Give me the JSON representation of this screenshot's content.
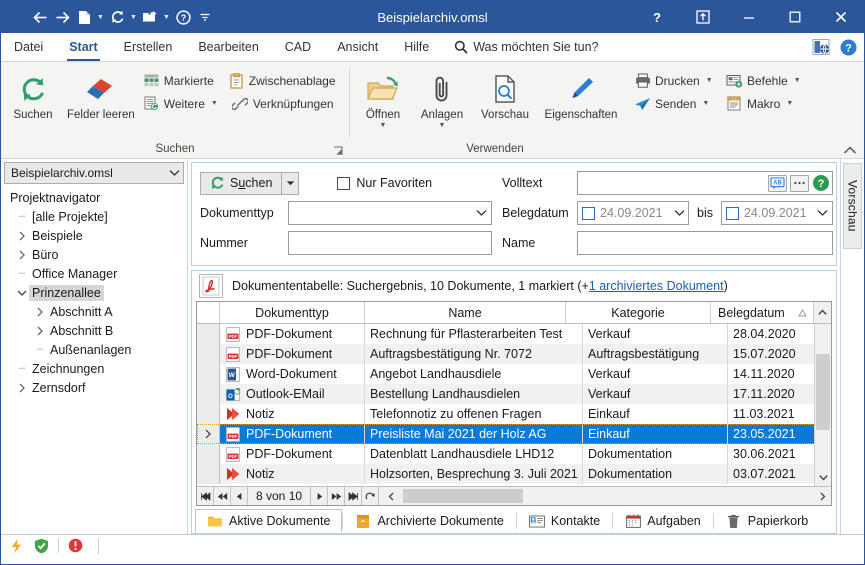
{
  "window": {
    "title": "Beispielarchiv.omsl",
    "quick_access": [
      {
        "name": "back",
        "icon": "arrow-left-icon",
        "caret": false
      },
      {
        "name": "forward",
        "icon": "arrow-right-icon",
        "caret": false
      },
      {
        "name": "new",
        "icon": "new-document-icon",
        "caret": true
      },
      {
        "name": "refresh",
        "icon": "refresh-icon",
        "caret": true
      },
      {
        "name": "open",
        "icon": "open-folder-icon",
        "caret": true
      },
      {
        "name": "help",
        "icon": "help-circle-icon",
        "caret": false
      },
      {
        "name": "customize",
        "icon": "overflow-icon",
        "caret": false
      }
    ],
    "controls": [
      {
        "name": "help",
        "glyph": "?"
      },
      {
        "name": "ribbon-display-options",
        "glyph": "⬆"
      },
      {
        "name": "minimize",
        "glyph": "—"
      },
      {
        "name": "maximize",
        "glyph": "□"
      },
      {
        "name": "close",
        "glyph": "✕"
      }
    ]
  },
  "ribbon": {
    "tabs": [
      {
        "label": "Datei",
        "active": false
      },
      {
        "label": "Start",
        "active": true
      },
      {
        "label": "Erstellen",
        "active": false
      },
      {
        "label": "Bearbeiten",
        "active": false
      },
      {
        "label": "CAD",
        "active": false
      },
      {
        "label": "Ansicht",
        "active": false
      },
      {
        "label": "Hilfe",
        "active": false
      }
    ],
    "tell_me": "Was möchten Sie tun?",
    "groups": [
      {
        "name": "suchen",
        "label": "Suchen",
        "big_buttons": [
          {
            "label": "Suchen",
            "icon": "refresh-green-icon",
            "caret": false
          },
          {
            "label": "Felder leeren",
            "icon": "eraser-icon",
            "caret": false
          }
        ],
        "small_buttons": [
          {
            "label": "Markierte",
            "icon": "grid-icon",
            "caret": false
          },
          {
            "label": "Zwischenablage",
            "icon": "clipboard-icon",
            "caret": false
          },
          {
            "label": "Weitere",
            "icon": "list-refresh-icon",
            "caret": true
          },
          {
            "label": "Verknüpfungen",
            "icon": "link-icon",
            "caret": false
          }
        ],
        "has_dialog_launcher": true
      },
      {
        "name": "verwenden",
        "label": "Verwenden",
        "big_buttons": [
          {
            "label": "Öffnen",
            "icon": "open-folder-arrow-icon",
            "caret": true
          },
          {
            "label": "Anlagen",
            "icon": "paperclip-icon",
            "caret": true
          },
          {
            "label": "Vorschau",
            "icon": "document-search-icon",
            "caret": false
          },
          {
            "label": "Eigenschaften",
            "icon": "pencil-icon",
            "caret": false
          }
        ],
        "small_buttons": [
          {
            "label": "Drucken",
            "icon": "printer-icon",
            "caret": true
          },
          {
            "label": "Befehle",
            "icon": "commands-icon",
            "caret": true
          },
          {
            "label": "Senden",
            "icon": "send-icon",
            "caret": true
          },
          {
            "label": "Makro",
            "icon": "macro-icon",
            "caret": true
          }
        ],
        "has_dialog_launcher": false
      }
    ],
    "collapse_label": "ⱏ"
  },
  "sidebar": {
    "archive_selector": "Beispielarchiv.omsl",
    "header": "Projektnavigator",
    "items": [
      {
        "label": "[alle Projekte]",
        "indent": 0,
        "twisty": "none",
        "selected": false
      },
      {
        "label": "Beispiele",
        "indent": 0,
        "twisty": "collapsed",
        "selected": false
      },
      {
        "label": "Büro",
        "indent": 0,
        "twisty": "collapsed",
        "selected": false
      },
      {
        "label": "Office Manager",
        "indent": 0,
        "twisty": "none",
        "selected": false
      },
      {
        "label": "Prinzenallee",
        "indent": 0,
        "twisty": "expanded",
        "selected": true
      },
      {
        "label": "Abschnitt A",
        "indent": 1,
        "twisty": "collapsed",
        "selected": false
      },
      {
        "label": "Abschnitt B",
        "indent": 1,
        "twisty": "collapsed",
        "selected": false
      },
      {
        "label": "Außenanlagen",
        "indent": 1,
        "twisty": "none",
        "selected": false
      },
      {
        "label": "Zeichnungen",
        "indent": 0,
        "twisty": "none",
        "selected": false
      },
      {
        "label": "Zernsdorf",
        "indent": 0,
        "twisty": "collapsed",
        "selected": false
      }
    ]
  },
  "search_form": {
    "search_button": {
      "prefix": "S",
      "accel": "u",
      "suffix": "chen"
    },
    "favorites_checkbox": {
      "label": "Nur Favoriten",
      "checked": false
    },
    "fields": {
      "dokumenttyp": {
        "label": "Dokumenttyp",
        "value": "",
        "type": "combo"
      },
      "nummer": {
        "label": "Nummer",
        "value": "",
        "type": "text"
      },
      "volltext": {
        "label": "Volltext",
        "value": "",
        "type": "text"
      },
      "belegdatum": {
        "label": "Belegdatum",
        "from": {
          "value": "24.09.2021",
          "checked": false
        },
        "separator": "bis",
        "to": {
          "value": "24.09.2021",
          "checked": false
        }
      },
      "name": {
        "label": "Name",
        "value": "",
        "type": "text"
      }
    }
  },
  "result": {
    "summary_prefix": "Dokumententabelle: Suchergebnis, 10 Dokumente, 1 markiert (+",
    "summary_link": "1 archiviertes Dokument",
    "summary_suffix": ")",
    "icon": "pdf-icon"
  },
  "table": {
    "columns": [
      "Dokumenttyp",
      "Name",
      "Kategorie",
      "Belegdatum"
    ],
    "sort_column": "Belegdatum",
    "sort_direction": "ascending",
    "rows": [
      {
        "icon": "pdf-icon",
        "dokumenttyp": "PDF-Dokument",
        "name": "Rechnung für Pflasterarbeiten Test",
        "kategorie": "Verkauf",
        "belegdatum": "28.04.2020",
        "selected": false
      },
      {
        "icon": "pdf-icon",
        "dokumenttyp": "PDF-Dokument",
        "name": "Auftragsbestätigung Nr. 7072",
        "kategorie": "Auftragsbestätigung",
        "belegdatum": "15.07.2020",
        "selected": false
      },
      {
        "icon": "word-icon",
        "dokumenttyp": "Word-Dokument",
        "name": "Angebot Landhausdiele",
        "kategorie": "Verkauf",
        "belegdatum": "14.11.2020",
        "selected": false
      },
      {
        "icon": "outlook-icon",
        "dokumenttyp": "Outlook-EMail",
        "name": "Bestellung Landhausdielen",
        "kategorie": "Verkauf",
        "belegdatum": "17.11.2020",
        "selected": false
      },
      {
        "icon": "note-icon",
        "dokumenttyp": "Notiz",
        "name": "Telefonnotiz zu offenen Fragen",
        "kategorie": "Einkauf",
        "belegdatum": "11.03.2021",
        "selected": false
      },
      {
        "icon": "pdf-icon",
        "dokumenttyp": "PDF-Dokument",
        "name": "Preisliste Mai 2021 der Holz AG",
        "kategorie": "Einkauf",
        "belegdatum": "23.05.2021",
        "selected": true
      },
      {
        "icon": "pdf-icon",
        "dokumenttyp": "PDF-Dokument",
        "name": "Datenblatt Landhausdiele LHD12",
        "kategorie": "Dokumentation",
        "belegdatum": "30.06.2021",
        "selected": false
      },
      {
        "icon": "note-icon",
        "dokumenttyp": "Notiz",
        "name": "Holzsorten, Besprechung 3. Juli 2021",
        "kategorie": "Dokumentation",
        "belegdatum": "03.07.2021",
        "selected": false
      }
    ],
    "navigator": {
      "first": "⏮",
      "prev_page": "⏪",
      "prev": "◀",
      "position": "8 von 10",
      "next": "▶",
      "next_page": "⏩",
      "last": "⏭",
      "refresh": "↷"
    }
  },
  "bottom_tabs": [
    {
      "label": "Aktive Dokumente",
      "icon": "folder-icon",
      "active": true
    },
    {
      "label": "Archivierte Dokumente",
      "icon": "archive-box-icon",
      "active": false
    },
    {
      "label": "Kontakte",
      "icon": "contact-card-icon",
      "active": false
    },
    {
      "label": "Aufgaben",
      "icon": "calendar-icon",
      "active": false
    },
    {
      "label": "Papierkorb",
      "icon": "trash-icon",
      "active": false
    }
  ],
  "preview_panel": {
    "label": "Vorschau"
  },
  "statusbar": {
    "icons": [
      {
        "name": "lightning-icon",
        "color": "#f0a828"
      },
      {
        "name": "shield-check-icon",
        "color": "#3fa34d"
      },
      {
        "name": "error-icon",
        "color": "#d63a3a"
      }
    ]
  },
  "colors": {
    "titlebar": "#2b579a",
    "accent": "#2b579a",
    "selection": "#0a7bd4",
    "ribbon_bg": "#f4f4f2",
    "link": "#1a5fb4"
  }
}
